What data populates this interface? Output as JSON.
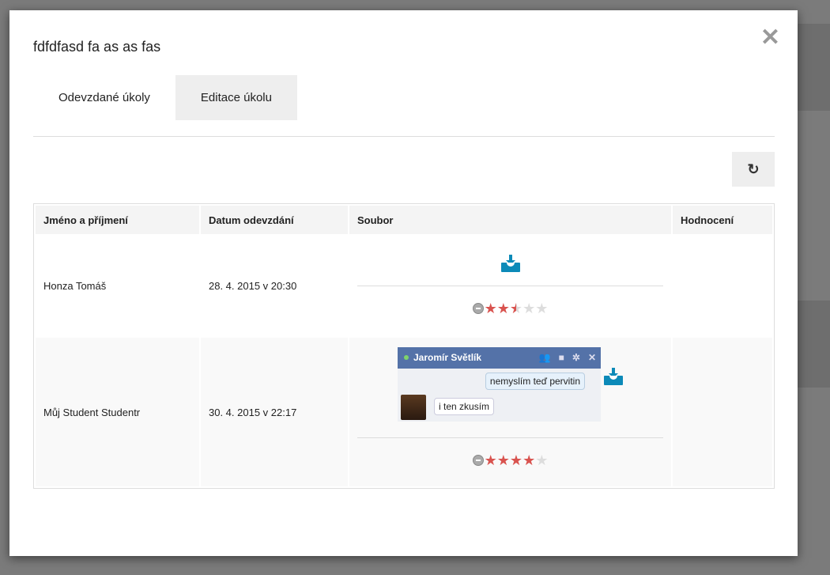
{
  "modal": {
    "title": "fdfdfasd fa as as fas",
    "close_icon": "close-icon",
    "tabs": [
      {
        "label": "Odevzdané úkoly",
        "active": false
      },
      {
        "label": "Editace úkolu",
        "active": true
      }
    ],
    "refresh_icon": "refresh-icon",
    "table": {
      "headers": [
        "Jméno a příjmení",
        "Datum odevzdání",
        "Soubor",
        "Hodnocení"
      ],
      "rows": [
        {
          "name": "Honza Tomáš",
          "date": "28. 4. 2015 v 20:30",
          "rating": 2.5,
          "rating_max": 5
        },
        {
          "name": "Můj Student Studentr",
          "date": "30. 4. 2015 v 22:17",
          "rating": 4,
          "rating_max": 5,
          "preview": {
            "chat_name": "Jaromír Světlík",
            "msg_out": "nemyslím teď pervitin",
            "msg_in": "i ten zkusím"
          }
        }
      ]
    }
  },
  "colors": {
    "accent": "#0c8ab8",
    "star": "#d9534f",
    "chat_header": "#5472a8"
  }
}
